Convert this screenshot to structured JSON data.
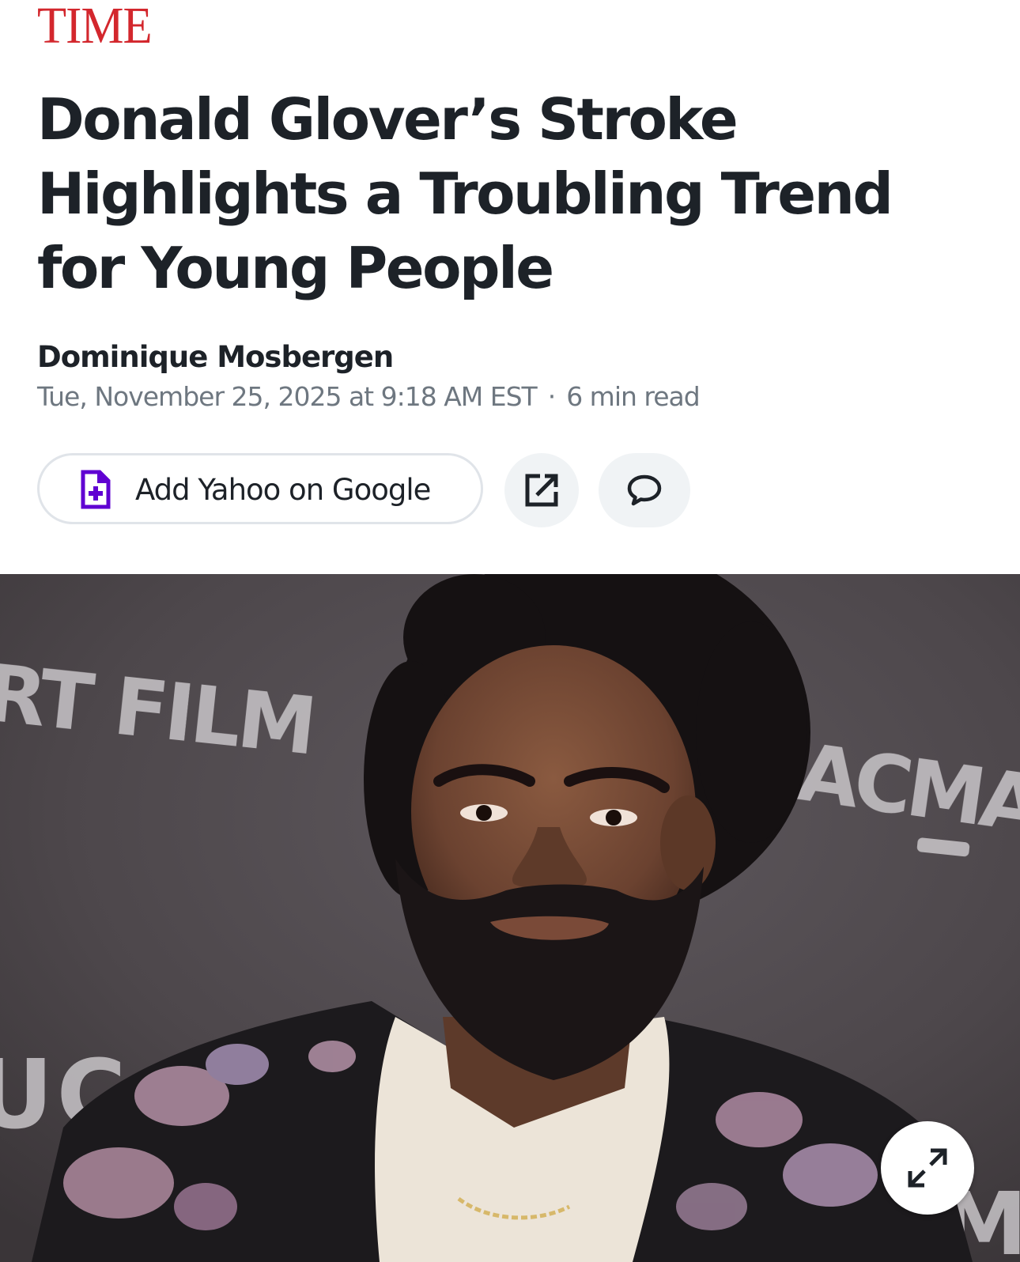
{
  "publisher": {
    "logo_text": "TIME",
    "logo_color": "#d3272d"
  },
  "article": {
    "headline": "Donald Glover’s Stroke Highlights a Troubling Trend for Young People",
    "author": "Dominique Mosbergen",
    "published": "Tue, November 25, 2025 at 9:18 AM EST",
    "separator": "·",
    "read_time": "6 min read"
  },
  "actions": {
    "add_yahoo_label": "Add Yahoo on Google",
    "add_icon": "document-plus-icon",
    "share_icon": "share-external-icon",
    "comment_icon": "comment-bubble-icon",
    "accent_color": "#6001d2"
  },
  "hero_image": {
    "backdrop_text_left": "RT FILM",
    "backdrop_text_right": "ACMA",
    "backdrop_text_lower_left": "UC",
    "backdrop_text_lower_right": "M",
    "expand_icon": "expand-arrows-icon"
  }
}
